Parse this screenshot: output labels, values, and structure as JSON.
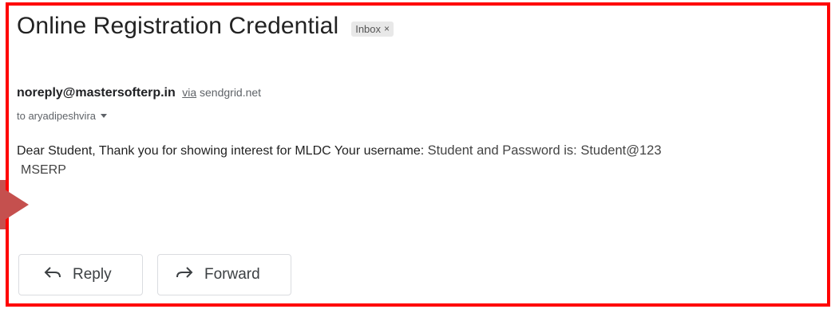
{
  "email": {
    "subject": "Online Registration Credential",
    "label": "Inbox",
    "label_close": "×",
    "sender": "noreply@mastersofterp.in",
    "via_word": "via",
    "via_domain": "sendgrid.net",
    "recipient": "to aryadipeshvira",
    "body_part1": "Dear Student, Thank you for showing interest for MLDC Your username: ",
    "body_part2": "Student and Password is: Student@123",
    "body_line2": "MSERP"
  },
  "actions": {
    "reply_label": "Reply",
    "forward_label": "Forward"
  },
  "colors": {
    "highlight_border": "#ff0000",
    "pointer_arrow": "#c5504e"
  },
  "icons": {
    "reply": "reply-arrow-icon",
    "forward": "forward-arrow-icon",
    "recipient_details": "caret-down-icon",
    "pointer": "pointer-arrow"
  }
}
